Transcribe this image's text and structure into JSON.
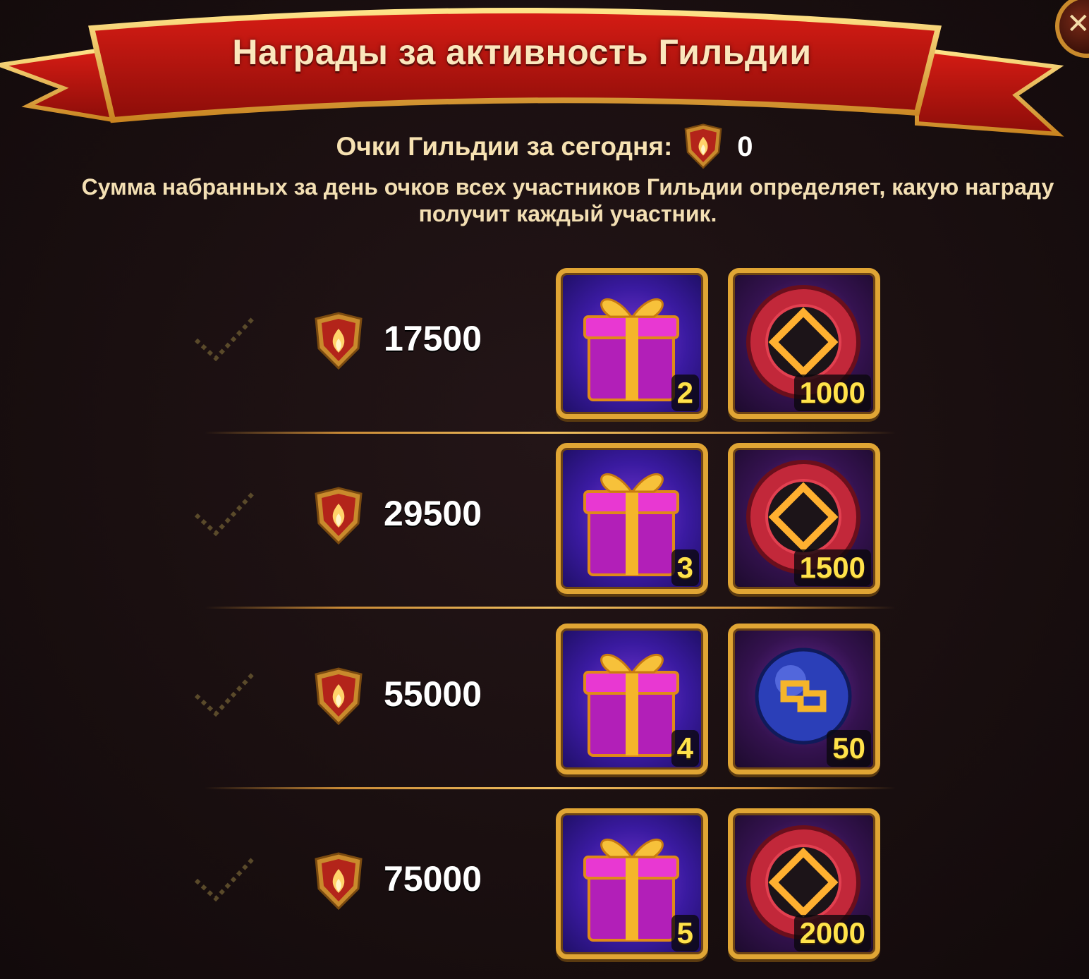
{
  "window": {
    "title": "Награды за активность Гильдии"
  },
  "header": {
    "points_label": "Очки Гильдии за сегодня:",
    "points_value": "0",
    "description": "Сумма набранных за день очков всех участников Гильдии определяет, какую награду получит каждый участник."
  },
  "icons": {
    "guild_points": "guild-points-shield-icon",
    "check": "check-icon",
    "gift": "gift-box-icon",
    "token": "red-coin-icon",
    "orb": "blue-orb-icon",
    "close": "close-icon"
  },
  "colors": {
    "banner_red": "#b3140f",
    "gold": "#e0a534",
    "count_yellow": "#ffe24a"
  },
  "tiers": [
    {
      "threshold": "17500",
      "rewards": [
        {
          "type": "gift",
          "count": "2"
        },
        {
          "type": "token",
          "count": "1000"
        }
      ]
    },
    {
      "threshold": "29500",
      "rewards": [
        {
          "type": "gift",
          "count": "3"
        },
        {
          "type": "token",
          "count": "1500"
        }
      ]
    },
    {
      "threshold": "55000",
      "rewards": [
        {
          "type": "gift",
          "count": "4"
        },
        {
          "type": "orb",
          "count": "50"
        }
      ]
    },
    {
      "threshold": "75000",
      "rewards": [
        {
          "type": "gift",
          "count": "5"
        },
        {
          "type": "token",
          "count": "2000"
        }
      ]
    }
  ]
}
